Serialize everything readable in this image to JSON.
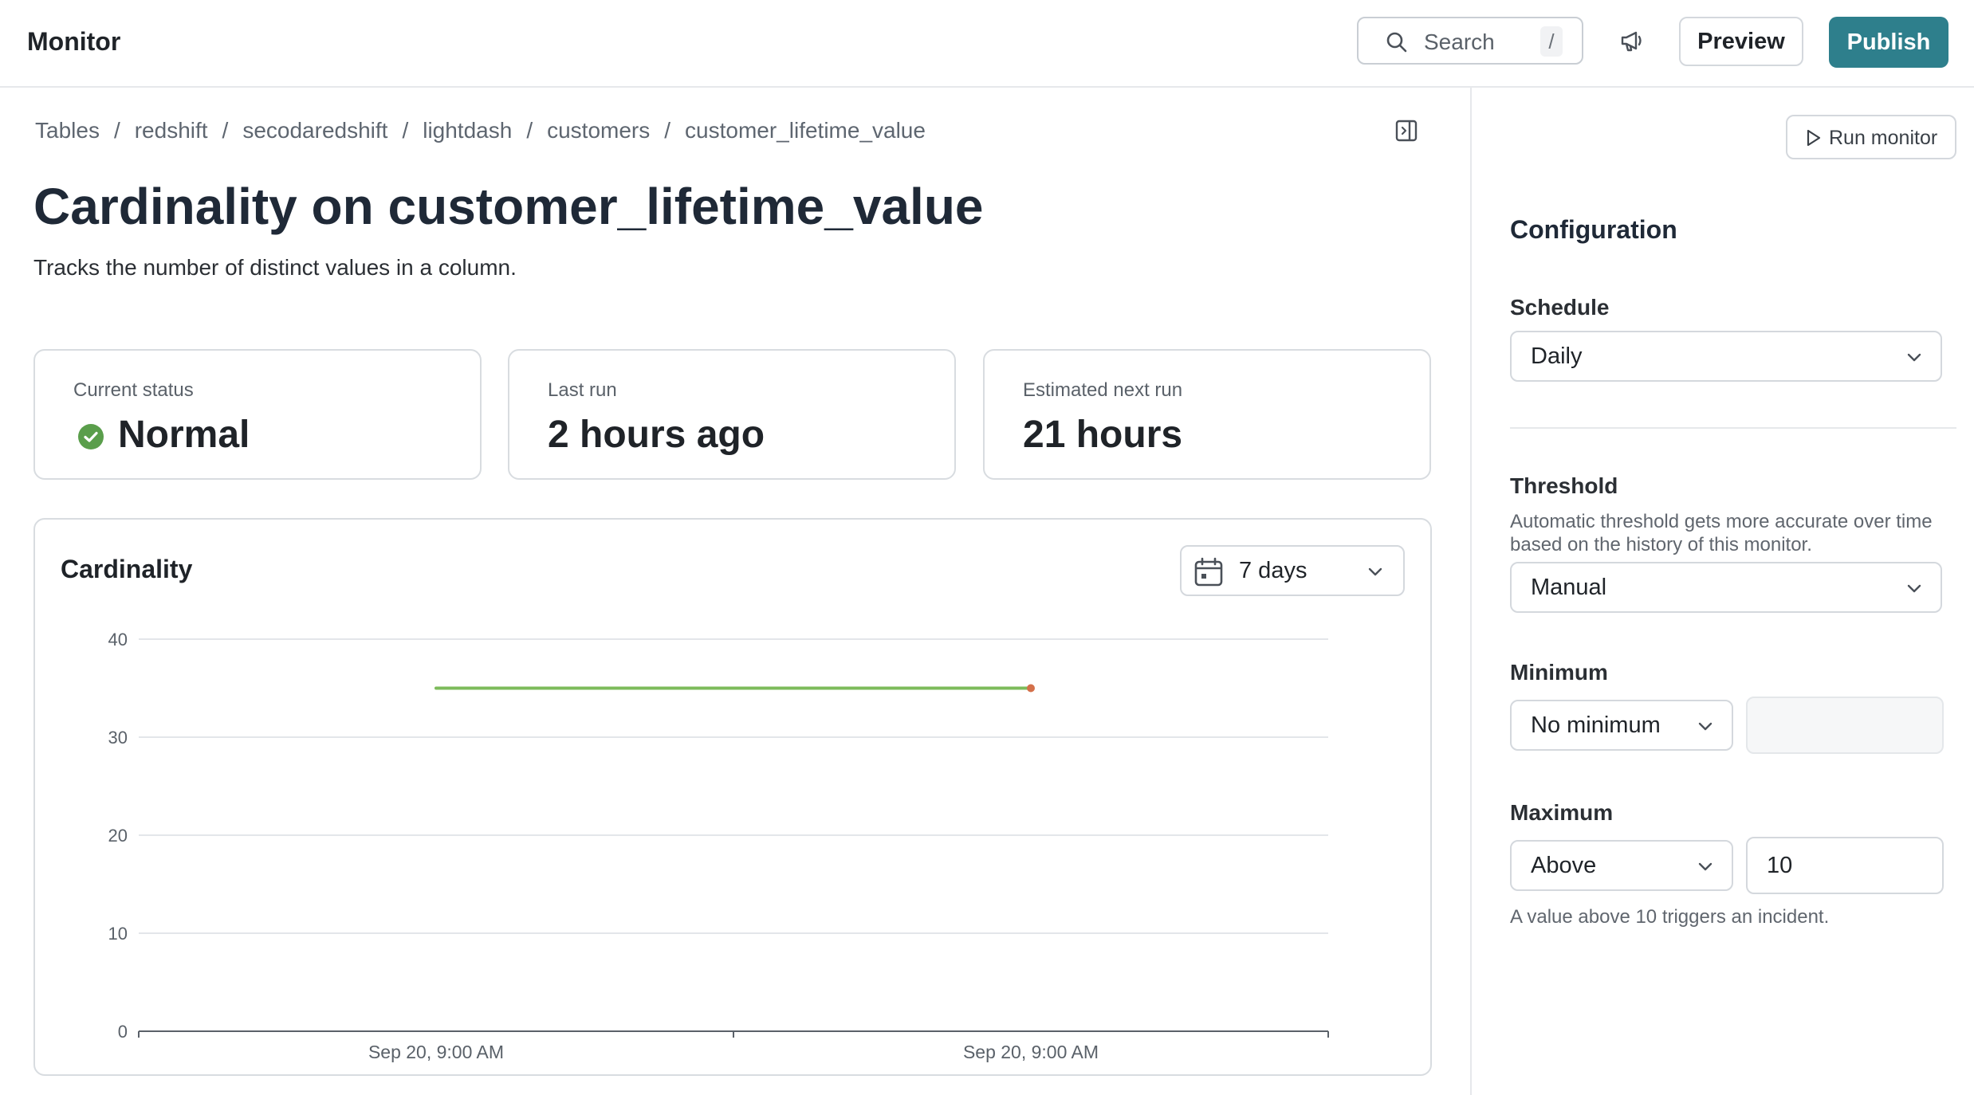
{
  "header": {
    "title": "Monitor",
    "search_placeholder": "Search",
    "search_shortcut": "/",
    "preview_label": "Preview",
    "publish_label": "Publish",
    "publish_color": "#2e7f8c"
  },
  "breadcrumb": [
    "Tables",
    "redshift",
    "secodaredshift",
    "lightdash",
    "customers",
    "customer_lifetime_value"
  ],
  "page": {
    "title": "Cardinality on customer_lifetime_value",
    "description": "Tracks the number of distinct values in a column."
  },
  "stats": {
    "status_label": "Current status",
    "status_value": "Normal",
    "status_color": "#5a9e4b",
    "last_run_label": "Last run",
    "last_run_value": "2 hours ago",
    "next_run_label": "Estimated next run",
    "next_run_value": "21 hours"
  },
  "chart_panel": {
    "title": "Cardinality",
    "range": "7 days"
  },
  "chart_data": {
    "type": "line",
    "title": "Cardinality",
    "x": [
      "Sep 20, 9:00 AM",
      "Sep 20, 9:00 AM"
    ],
    "series": [
      {
        "values": [
          35,
          35
        ],
        "color": "#7dbb5b",
        "last_point_color": "#d4704a"
      }
    ],
    "y_ticks": [
      0,
      10,
      20,
      30,
      40
    ],
    "ylim": [
      0,
      40
    ],
    "grid": true,
    "xlabel": "",
    "ylabel": ""
  },
  "sidebar": {
    "run_monitor_label": "Run monitor",
    "config_title": "Configuration",
    "schedule_label": "Schedule",
    "schedule_value": "Daily",
    "threshold_label": "Threshold",
    "threshold_help": "Automatic threshold gets more accurate over time based on the history of this monitor.",
    "threshold_value": "Manual",
    "minimum_label": "Minimum",
    "minimum_mode": "No minimum",
    "minimum_value": "",
    "maximum_label": "Maximum",
    "maximum_mode": "Above",
    "maximum_value": "10",
    "maximum_help": "A value above 10 triggers an incident."
  }
}
